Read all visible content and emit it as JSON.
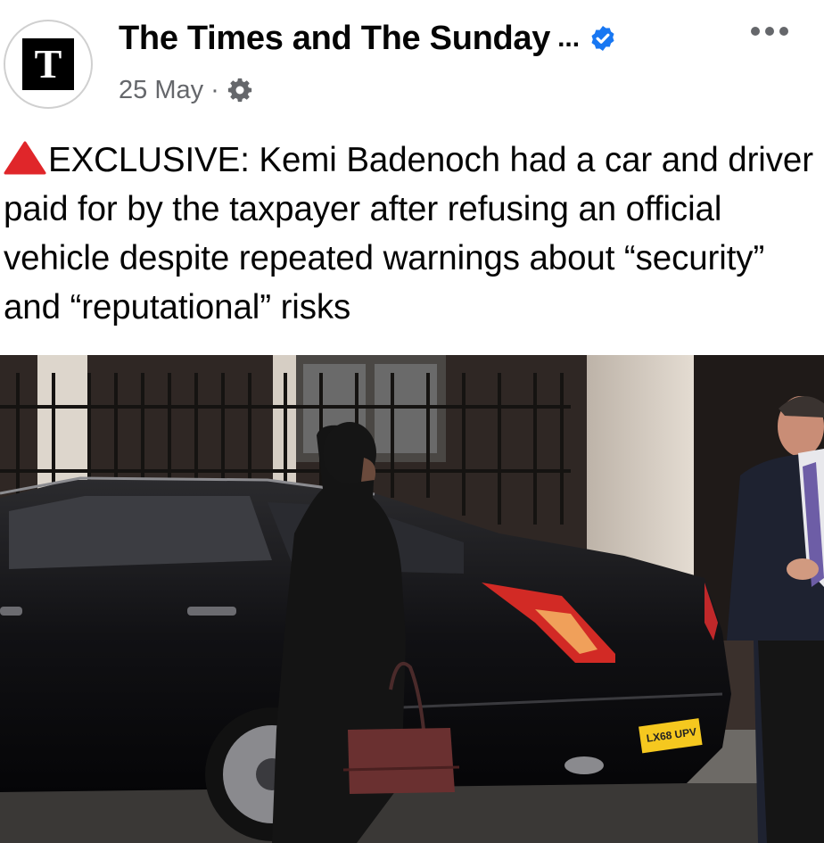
{
  "post": {
    "page_name": "The Times and The Sunday",
    "truncation": "...",
    "avatar_letter": "T",
    "date": "25 May",
    "separator": "·",
    "text": "EXCLUSIVE: Kemi Badenoch had a car and driver paid for by the taxpayer after refusing an official vehicle despite repeated warnings about “security” and “reputational” risks",
    "image": {
      "plate": "LX68 UPV"
    }
  },
  "icons": {
    "verified": "verified-badge-icon",
    "more": "more-options-icon",
    "audience": "gear-icon",
    "alert": "red-triangle-icon"
  },
  "colors": {
    "verified": "#1877f2",
    "secondary_text": "#65676b",
    "alert": "#e0262a"
  }
}
